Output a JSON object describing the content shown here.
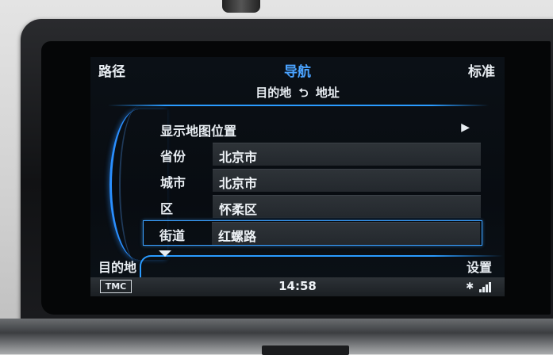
{
  "header": {
    "left": "路径",
    "center": "导航",
    "right": "标准"
  },
  "breadcrumb": {
    "from": "目的地",
    "arrow": "⮌",
    "to": "地址"
  },
  "map_row": {
    "label": "显示地图位置",
    "chevron": "▶"
  },
  "fields": [
    {
      "label": "省份",
      "value": "北京市"
    },
    {
      "label": "城市",
      "value": "北京市"
    },
    {
      "label": "区",
      "value": "怀柔区"
    },
    {
      "label": "街道",
      "value": "红螺路"
    }
  ],
  "bottom": {
    "left_tab": "目的地",
    "right_button": "设置"
  },
  "status": {
    "tmc": "TMC",
    "time": "14:58",
    "bluetooth": "✱",
    "signal_icon": "signal-bars-icon"
  },
  "colors": {
    "accent": "#2a9bff",
    "title_blue": "#4aa3ff",
    "text": "#e8edf2"
  }
}
